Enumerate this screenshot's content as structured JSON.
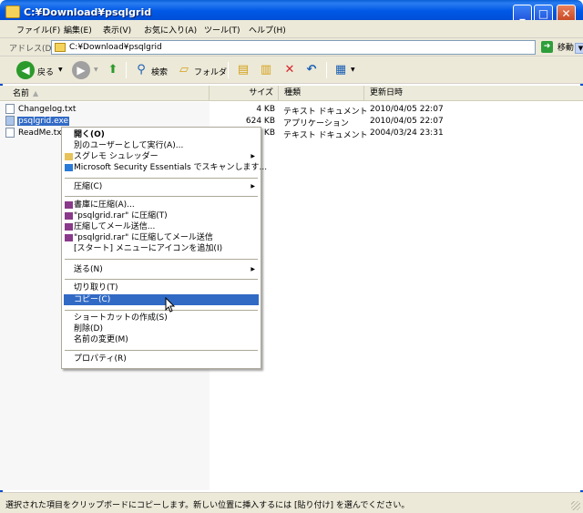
{
  "window": {
    "title": "C:¥Download¥psqlgrid",
    "minimize_glyph": "_",
    "maximize_glyph": "□",
    "close_glyph": "✕"
  },
  "menubar": {
    "items": [
      "ファイル(F)",
      "編集(E)",
      "表示(V)",
      "お気に入り(A)",
      "ツール(T)",
      "ヘルプ(H)"
    ]
  },
  "address": {
    "label": "アドレス(D)",
    "value": "C:¥Download¥psqlgrid",
    "go_label": "移動"
  },
  "toolbar": {
    "back_label": "戻る",
    "search_label": "検索",
    "folders_label": "フォルダ"
  },
  "columns": {
    "name": "名前",
    "size": "サイズ",
    "type": "種類",
    "date": "更新日時"
  },
  "files": [
    {
      "name": "Changelog.txt",
      "size": "4 KB",
      "type": "テキスト ドキュメント",
      "date": "2010/04/05 22:07",
      "icon": "text-file-icon"
    },
    {
      "name": "psqlgrid.exe",
      "size": "624 KB",
      "type": "アプリケーション",
      "date": "2010/04/05 22:07",
      "icon": "exe-file-icon"
    },
    {
      "name": "ReadMe.txt",
      "size": "1 KB",
      "type": "テキスト ドキュメント",
      "date": "2004/03/24 23:31",
      "icon": "text-file-icon"
    }
  ],
  "context_menu": {
    "items": [
      {
        "label": "開く(O)"
      },
      {
        "label": "別のユーザーとして実行(A)..."
      },
      {
        "label": "スグレモ シュレッダー"
      },
      {
        "label": "Microsoft Security Essentials でスキャンします..."
      },
      {
        "label": "圧縮(C)"
      },
      {
        "label": "書庫に圧縮(A)..."
      },
      {
        "label": "\"psqlgrid.rar\" に圧縮(T)"
      },
      {
        "label": "圧縮してメール送信..."
      },
      {
        "label": "\"psqlgrid.rar\" に圧縮してメール送信"
      },
      {
        "label": "[スタート] メニューにアイコンを追加(I)"
      },
      {
        "label": "送る(N)"
      },
      {
        "label": "切り取り(T)"
      },
      {
        "label": "コピー(C)"
      },
      {
        "label": "ショートカットの作成(S)"
      },
      {
        "label": "削除(D)"
      },
      {
        "label": "名前の変更(M)"
      },
      {
        "label": "プロパティ(R)"
      }
    ]
  },
  "status": {
    "text": "選択された項目をクリップボードにコピーします。新しい位置に挿入するには [貼り付け] を選んでください。"
  },
  "colors": {
    "selection": "#316ac5",
    "titlebar": "#0058e6",
    "chrome": "#ece9d8"
  }
}
